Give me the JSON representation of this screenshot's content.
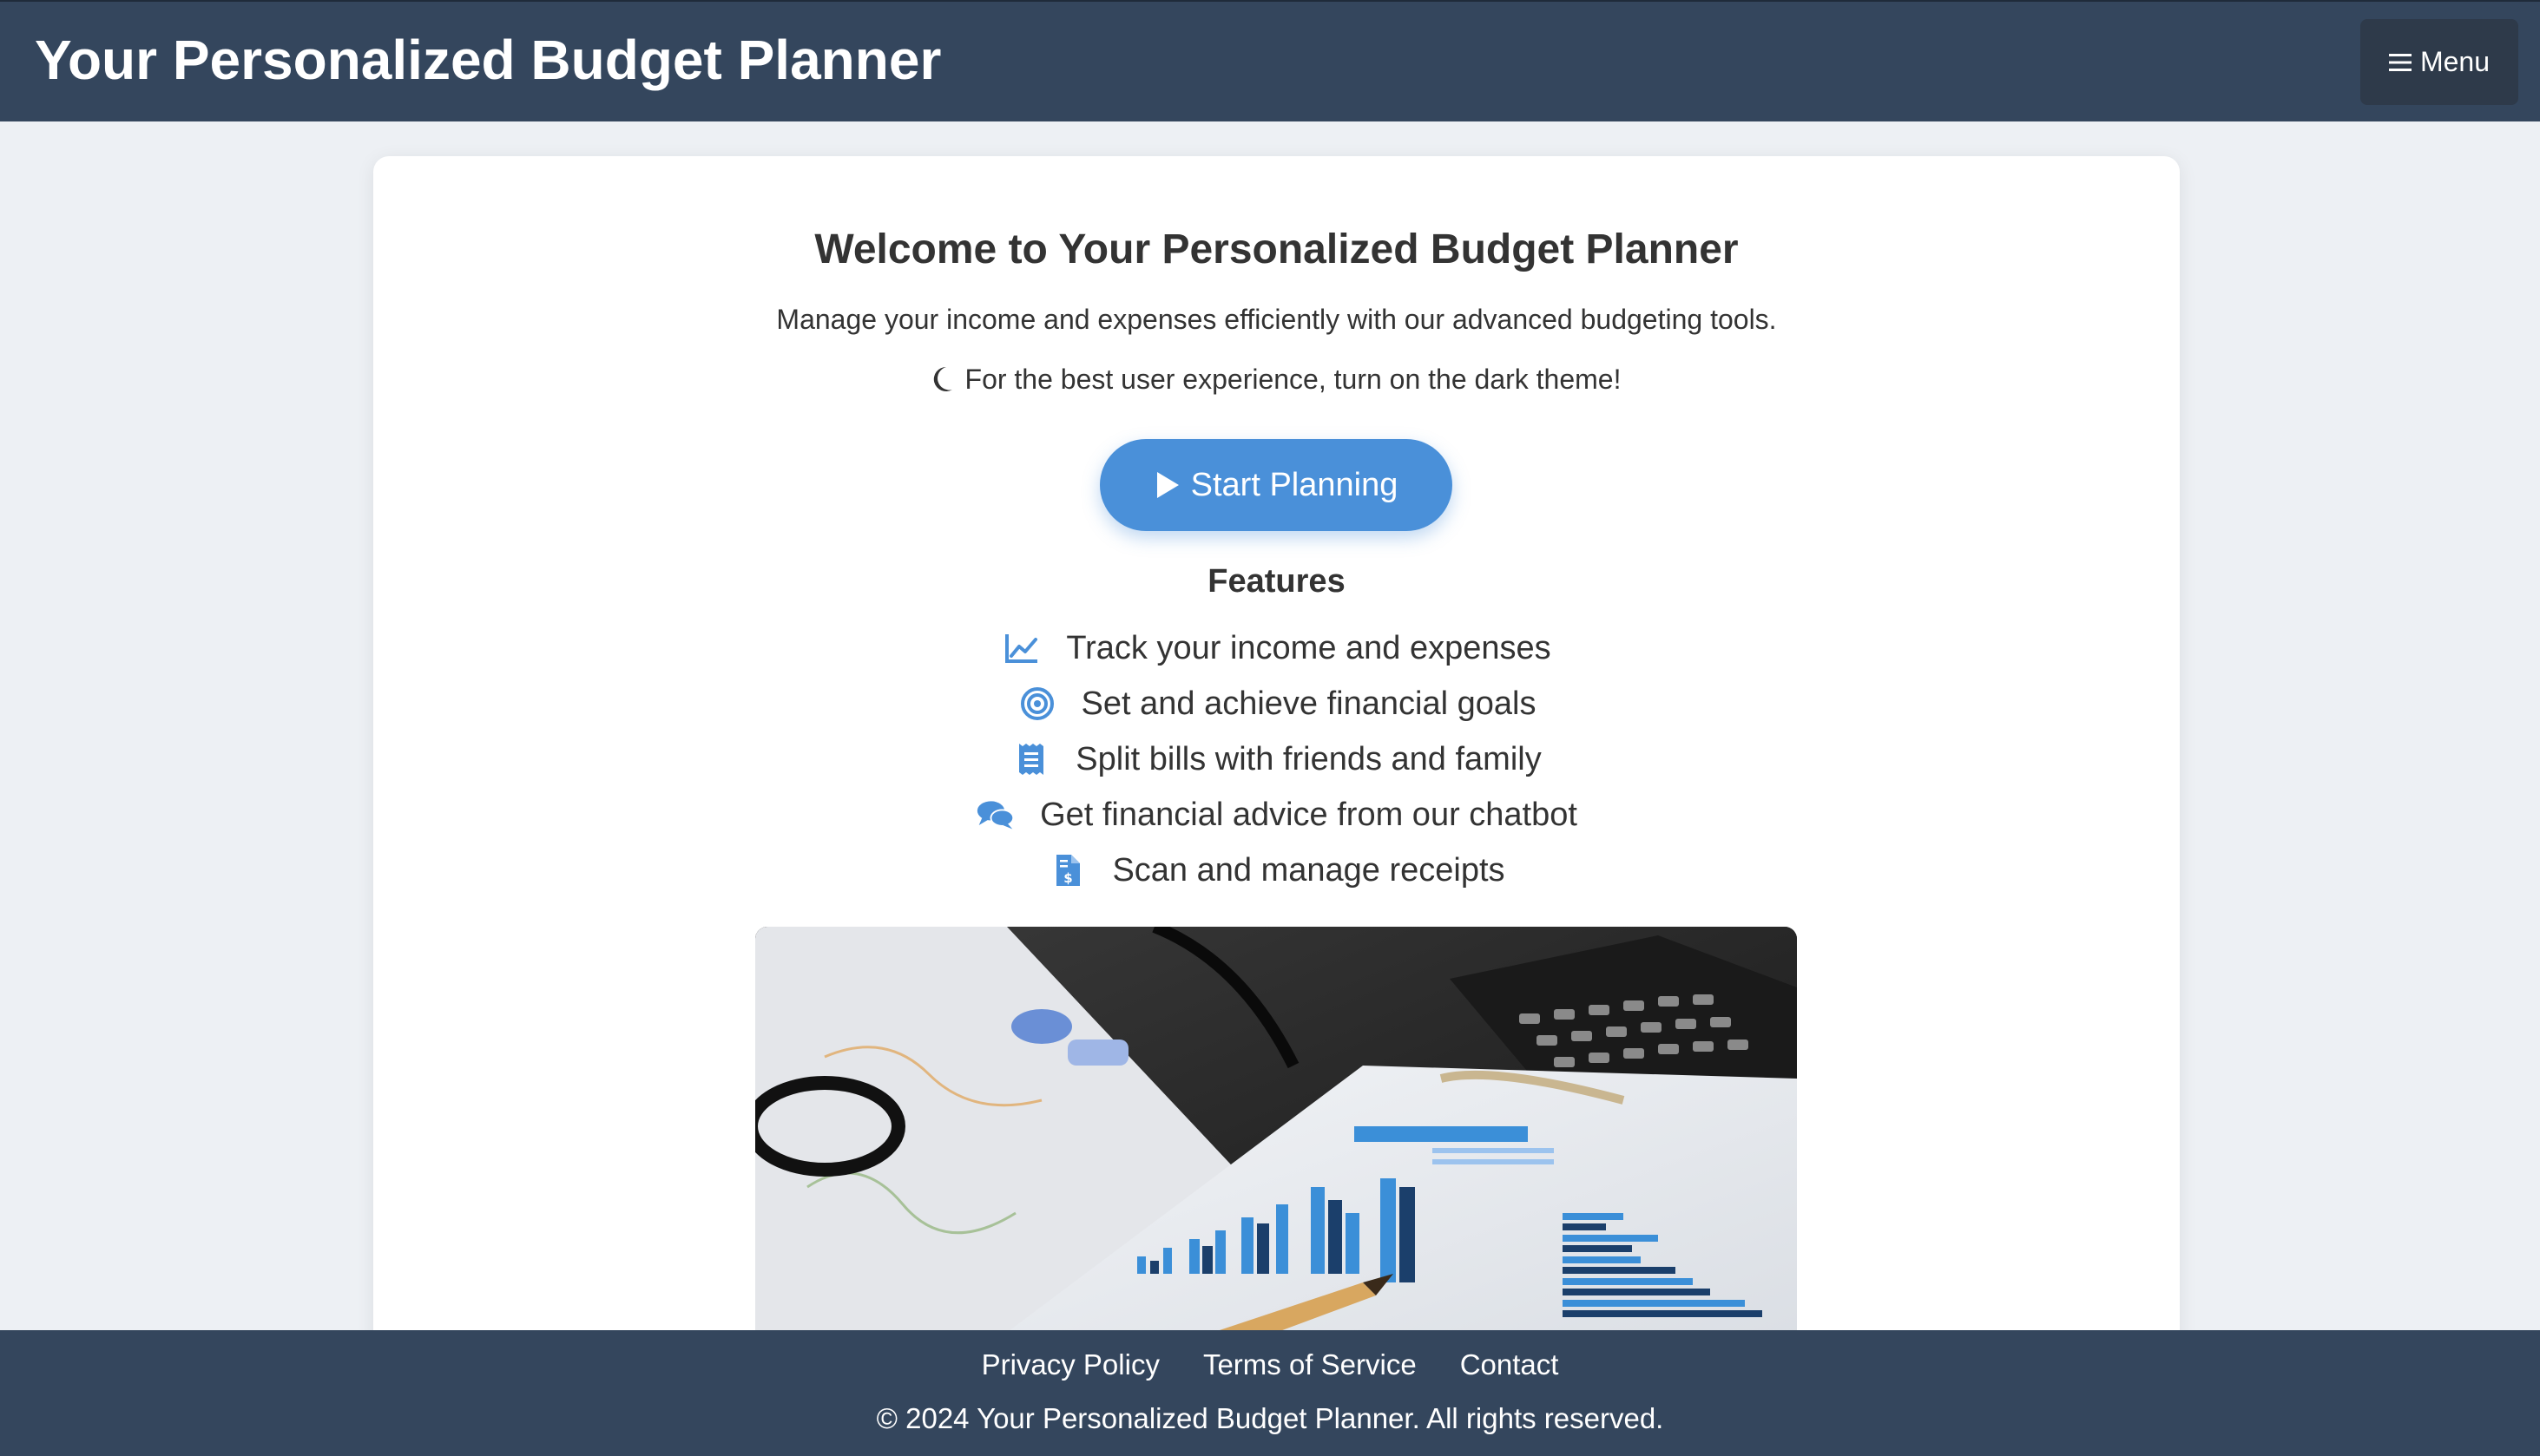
{
  "header": {
    "title": "Your Personalized Budget Planner",
    "menu_label": "Menu"
  },
  "main": {
    "welcome_title": "Welcome to Your Personalized Budget Planner",
    "subtitle": "Manage your income and expenses efficiently with our advanced budgeting tools.",
    "dark_theme_tip": "For the best user experience, turn on the dark theme!",
    "start_button_label": "Start Planning",
    "features_title": "Features",
    "features": [
      {
        "icon": "chart-line-icon",
        "label": "Track your income and expenses"
      },
      {
        "icon": "target-icon",
        "label": "Set and achieve financial goals"
      },
      {
        "icon": "receipt-icon",
        "label": "Split bills with friends and family"
      },
      {
        "icon": "chat-bubbles-icon",
        "label": "Get financial advice from our chatbot"
      },
      {
        "icon": "invoice-dollar-icon",
        "label": "Scan and manage receipts"
      }
    ]
  },
  "footer": {
    "links": [
      "Privacy Policy",
      "Terms of Service",
      "Contact"
    ],
    "copyright": "© 2024 Your Personalized Budget Planner. All rights reserved."
  },
  "colors": {
    "header_bg": "#34465d",
    "accent": "#4a90d9",
    "page_bg": "#edf0f4"
  }
}
